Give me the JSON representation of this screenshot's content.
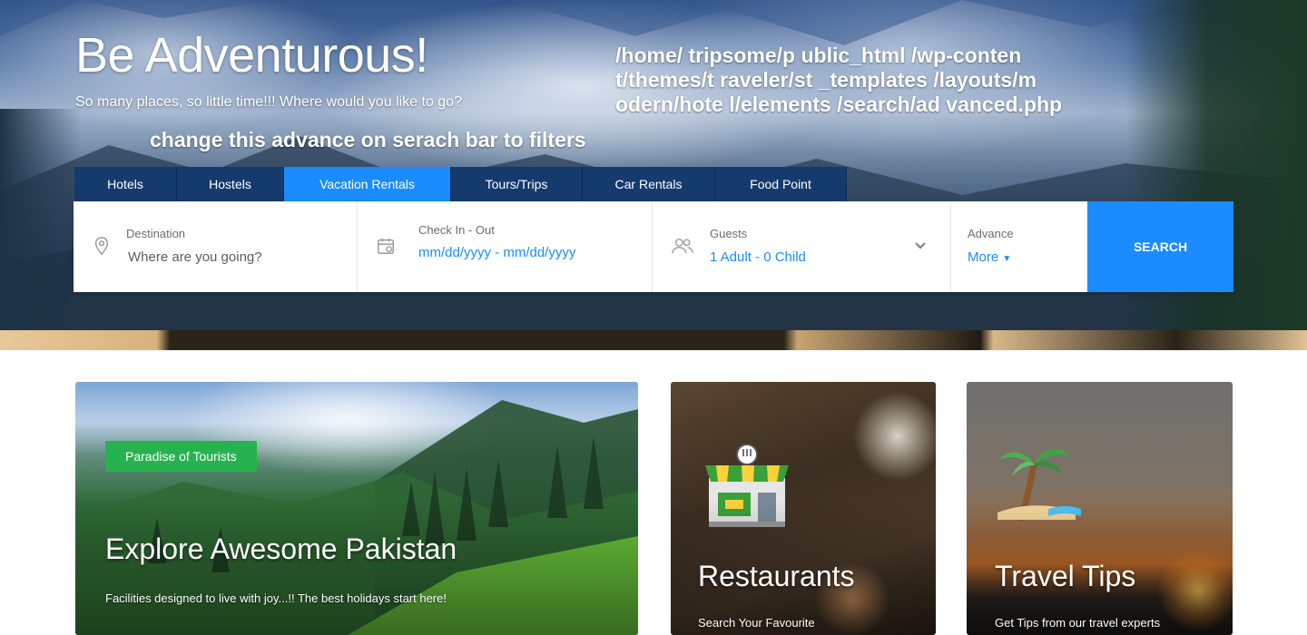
{
  "hero": {
    "title": "Be Adventurous!",
    "subtitle": "So many places, so little time!!! Where would you like to go?",
    "note": "change this advance on serach bar to filters",
    "path_lines": [
      "/home/ tripsome/p ublic_html /wp-conten",
      "t/themes/t raveler/st _templates /layouts/m",
      "odern/hote l/elements /search/ad vanced.php"
    ]
  },
  "tabs": [
    {
      "label": "Hotels",
      "active": false
    },
    {
      "label": "Hostels",
      "active": false
    },
    {
      "label": "Vacation Rentals",
      "active": true
    },
    {
      "label": "Tours/Trips",
      "active": false
    },
    {
      "label": "Car Rentals",
      "active": false
    },
    {
      "label": "Food Point",
      "active": false
    }
  ],
  "search": {
    "destination_label": "Destination",
    "destination_placeholder": "Where are you going?",
    "dates_label": "Check In - Out",
    "dates_value": "mm/dd/yyyy - mm/dd/yyyy",
    "guests_label": "Guests",
    "guests_value": "1 Adult - 0 Child",
    "advance_label": "Advance",
    "advance_value": "More",
    "button_label": "SEARCH"
  },
  "cards": {
    "pakistan": {
      "badge": "Paradise of Tourists",
      "title": "Explore Awesome Pakistan",
      "description": "Facilities designed to live with joy...!! The best holidays start here!"
    },
    "restaurants": {
      "title": "Restaurants",
      "description": "Search Your Favourite"
    },
    "tips": {
      "title": "Travel Tips",
      "description": "Get Tips from our travel experts"
    }
  },
  "colors": {
    "accent": "#1a8cff",
    "tab_bg": "#143a6e",
    "badge": "#26b34f"
  },
  "icons": [
    "map-pin-icon",
    "calendar-icon",
    "users-icon",
    "chevron-down-icon",
    "caret-down-icon",
    "restaurant-shop-icon",
    "palm-island-icon"
  ]
}
